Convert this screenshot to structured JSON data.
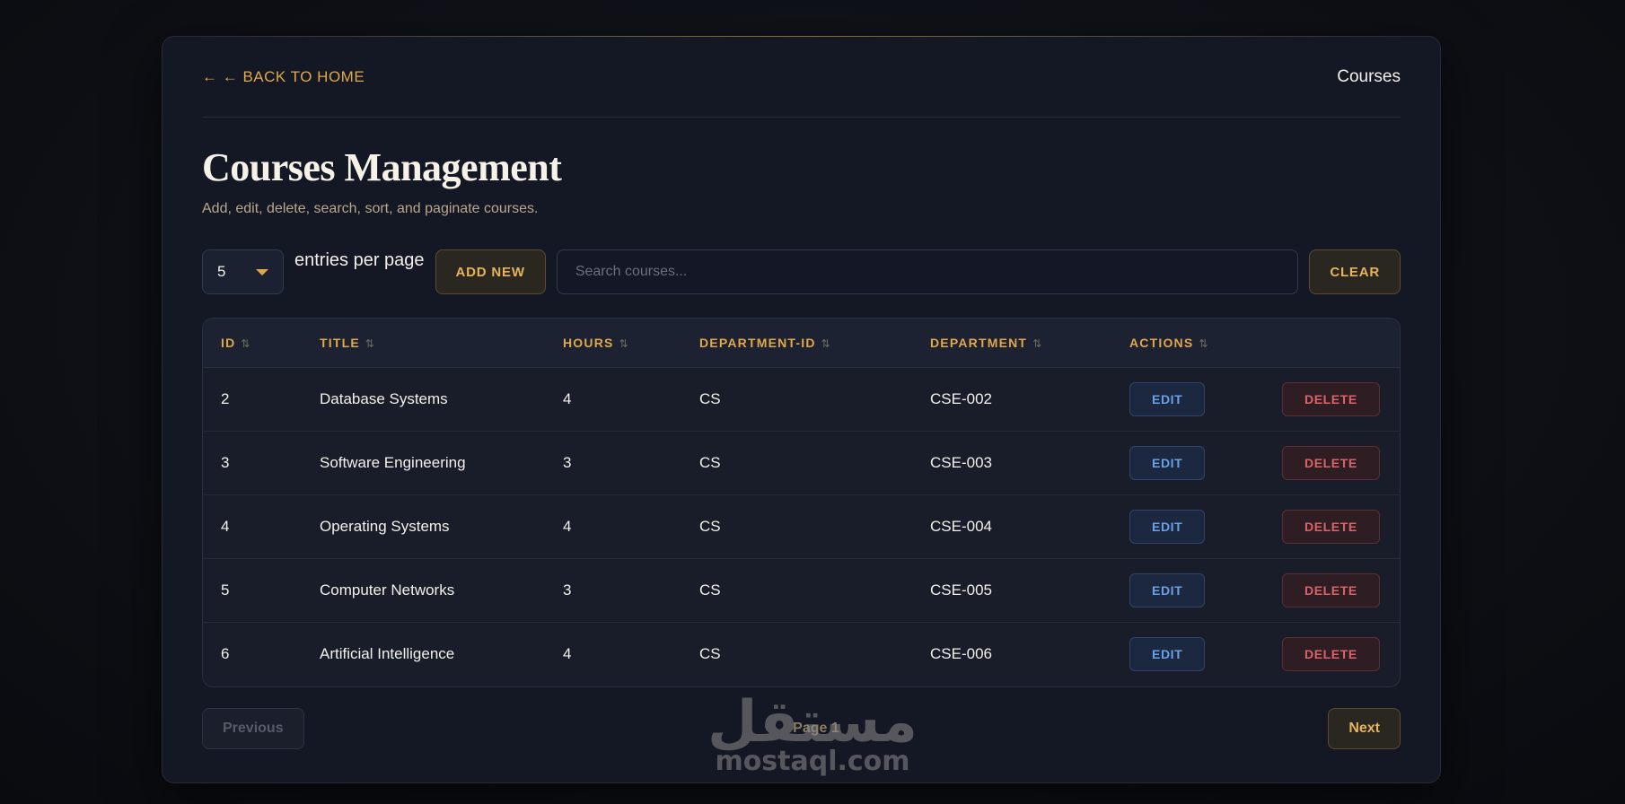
{
  "header": {
    "back_link": "← ← BACK TO HOME",
    "nav_title": "Courses"
  },
  "page": {
    "title": "Courses Management",
    "subtitle": "Add, edit, delete, search, sort, and paginate courses."
  },
  "controls": {
    "entries_value": "5",
    "entries_label": "entries per page",
    "add_new_label": "ADD NEW",
    "search_placeholder": "Search courses...",
    "clear_label": "CLEAR"
  },
  "table": {
    "columns": [
      "ID",
      "TITLE",
      "HOURS",
      "DEPARTMENT-ID",
      "DEPARTMENT",
      "ACTIONS"
    ],
    "sort_icon": "⇅",
    "edit_label": "EDIT",
    "delete_label": "DELETE",
    "rows": [
      {
        "id": "2",
        "title": "Database Systems",
        "hours": "4",
        "department_id": "CS",
        "department": "CSE-002"
      },
      {
        "id": "3",
        "title": "Software Engineering",
        "hours": "3",
        "department_id": "CS",
        "department": "CSE-003"
      },
      {
        "id": "4",
        "title": "Operating Systems",
        "hours": "4",
        "department_id": "CS",
        "department": "CSE-004"
      },
      {
        "id": "5",
        "title": "Computer Networks",
        "hours": "3",
        "department_id": "CS",
        "department": "CSE-005"
      },
      {
        "id": "6",
        "title": "Artificial Intelligence",
        "hours": "4",
        "department_id": "CS",
        "department": "CSE-006"
      }
    ]
  },
  "pagination": {
    "previous_label": "Previous",
    "page_indicator": "Page 1",
    "next_label": "Next"
  },
  "watermark": {
    "arabic": "مستقل",
    "latin": "mostaql.com"
  },
  "colors": {
    "accent": "#e0a84a",
    "edit": "#6aa0e6",
    "delete": "#d8646a",
    "card_bg": "#141824"
  }
}
